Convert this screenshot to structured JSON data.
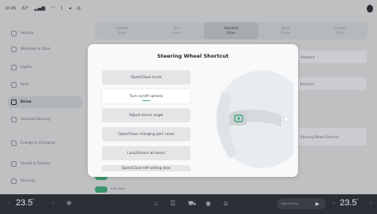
{
  "status_bar": {
    "time": "10:45",
    "temp": "32°",
    "icons": [
      "signal-icon",
      "wifi-icon",
      "bluetooth-icon",
      "volume-icon",
      "camera-icon"
    ]
  },
  "sidebar": {
    "items": [
      {
        "label": "Vehicle",
        "icon": "car-icon"
      },
      {
        "label": "Windows & Door",
        "icon": "door-icon"
      },
      {
        "label": "Lights",
        "icon": "light-icon"
      },
      {
        "label": "Seat",
        "icon": "seat-icon"
      },
      {
        "label": "Drive",
        "icon": "steering-icon",
        "active": true
      },
      {
        "label": "Assisted Driving",
        "icon": "assist-icon"
      },
      {
        "label": "Energy & Charging",
        "icon": "battery-icon"
      },
      {
        "label": "Sound & Display",
        "icon": "display-icon"
      },
      {
        "label": "Security",
        "icon": "shield-icon"
      }
    ]
  },
  "main": {
    "tabs": [
      {
        "label": "Comfort",
        "sub": "Drive"
      },
      {
        "label": "Eco",
        "sub": "Drive"
      },
      {
        "label": "Standard",
        "sub": "Drive",
        "active": true
      },
      {
        "label": "Sport",
        "sub": "Drive"
      },
      {
        "label": "Custom",
        "sub": "Drive"
      }
    ],
    "bg_fields": [
      "Standard",
      "Standard",
      "Dynamic",
      "Standard"
    ],
    "bg_hint": "Steering Wheel Shortcut",
    "bg_toggle_label": "Hill Hold",
    "bg_toggle_label2": "Auto Hold"
  },
  "dialog": {
    "title": "Steering Wheel Shortcut",
    "options": [
      "Open/Close trunk",
      "Turn on/off camera",
      "Adjust mirror angle",
      "Open/Close charging port cover",
      "Lock/Unlock all doors",
      "Open/Close left sliding door"
    ],
    "selected_index": 1,
    "accent": "#3ea676"
  },
  "bottom_bar": {
    "left_temp": "23.5",
    "right_temp": "23.5",
    "unit": "°",
    "media_text": "Now Playing",
    "icons": [
      "fan-icon",
      "seat-heat-icon",
      "defrost-icon",
      "car-icon",
      "steering-heat-icon",
      "volume-icon"
    ]
  }
}
